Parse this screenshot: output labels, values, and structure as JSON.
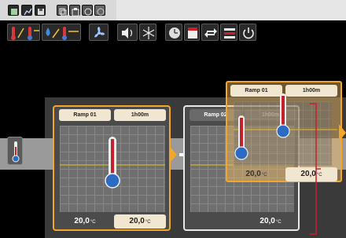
{
  "toolbar": {
    "row1": [
      "grid-icon",
      "chart-icon",
      "save-icon",
      "copy-icon",
      "paste-icon",
      "undo-icon",
      "redo-icon"
    ],
    "row2": [
      {
        "name": "temperature-ramp-heat-icon"
      },
      {
        "name": "temperature-hold-icon"
      },
      {
        "name": "humidity-ramp-icon"
      },
      {
        "name": "humidity-hold-icon"
      },
      {
        "name": "fan-icon"
      },
      {
        "name": "speaker-icon"
      },
      {
        "name": "snowflake-icon"
      },
      {
        "name": "clock-timer-icon"
      },
      {
        "name": "calendar-icon"
      },
      {
        "name": "loop-icon"
      },
      {
        "name": "bars-icon"
      },
      {
        "name": "power-icon"
      }
    ]
  },
  "blocks": [
    {
      "label": "Ramp 01",
      "time": "1h00m",
      "start_value": "20,0",
      "end_value": "20,0",
      "unit": "°C",
      "selected": true
    },
    {
      "label": "Ramp 02",
      "time": "1h00m",
      "start_value": "20,0",
      "end_value": "20,0",
      "unit": "°C",
      "selected": false
    }
  ],
  "drag_preview": {
    "label": "Ramp 01",
    "time": "1h00m",
    "start_value": "20,0",
    "end_value": "20,0",
    "unit": "°C"
  },
  "colors": {
    "accent": "#f4a62a",
    "thermometer_red": "#c8202a",
    "thermometer_blue": "#2b6bc4",
    "grid": "#6f6f6f",
    "trend_line": "#d8b22a"
  }
}
